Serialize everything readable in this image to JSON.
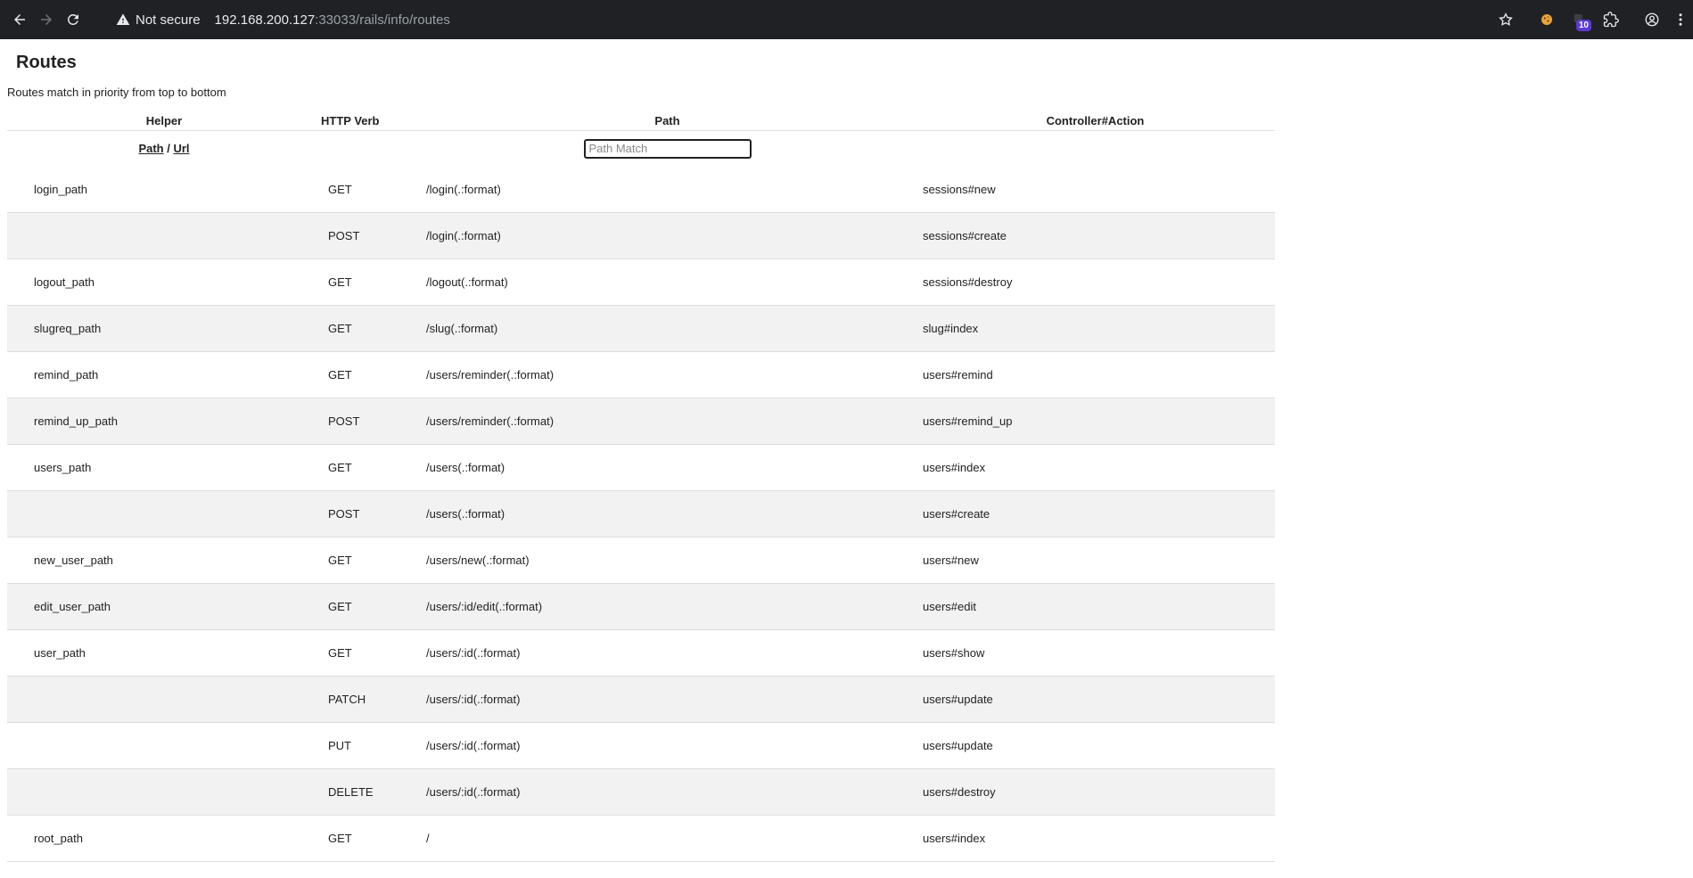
{
  "browser": {
    "security_label": "Not secure",
    "url_host": "192.168.200.127",
    "url_rest": ":33033/rails/info/routes",
    "extension_badge": "10",
    "icons": [
      "back-icon",
      "forward-icon",
      "reload-icon",
      "warning-icon",
      "star-icon",
      "extension-cookie-icon",
      "extension-badge-icon",
      "puzzle-icon",
      "profile-icon",
      "menu-icon"
    ]
  },
  "page": {
    "title": "Routes",
    "subtitle": "Routes match in priority from top to bottom"
  },
  "table": {
    "headers": {
      "helper": "Helper",
      "verb": "HTTP Verb",
      "path": "Path",
      "action": "Controller#Action"
    },
    "filter": {
      "path_link": "Path",
      "separator": " / ",
      "url_link": "Url",
      "search_placeholder": "Path Match"
    },
    "rows": [
      {
        "helper": "login_path",
        "verb": "GET",
        "path": "/login(.:format)",
        "action": "sessions#new"
      },
      {
        "helper": "",
        "verb": "POST",
        "path": "/login(.:format)",
        "action": "sessions#create"
      },
      {
        "helper": "logout_path",
        "verb": "GET",
        "path": "/logout(.:format)",
        "action": "sessions#destroy"
      },
      {
        "helper": "slugreq_path",
        "verb": "GET",
        "path": "/slug(.:format)",
        "action": "slug#index"
      },
      {
        "helper": "remind_path",
        "verb": "GET",
        "path": "/users/reminder(.:format)",
        "action": "users#remind"
      },
      {
        "helper": "remind_up_path",
        "verb": "POST",
        "path": "/users/reminder(.:format)",
        "action": "users#remind_up"
      },
      {
        "helper": "users_path",
        "verb": "GET",
        "path": "/users(.:format)",
        "action": "users#index"
      },
      {
        "helper": "",
        "verb": "POST",
        "path": "/users(.:format)",
        "action": "users#create"
      },
      {
        "helper": "new_user_path",
        "verb": "GET",
        "path": "/users/new(.:format)",
        "action": "users#new"
      },
      {
        "helper": "edit_user_path",
        "verb": "GET",
        "path": "/users/:id/edit(.:format)",
        "action": "users#edit"
      },
      {
        "helper": "user_path",
        "verb": "GET",
        "path": "/users/:id(.:format)",
        "action": "users#show"
      },
      {
        "helper": "",
        "verb": "PATCH",
        "path": "/users/:id(.:format)",
        "action": "users#update"
      },
      {
        "helper": "",
        "verb": "PUT",
        "path": "/users/:id(.:format)",
        "action": "users#update"
      },
      {
        "helper": "",
        "verb": "DELETE",
        "path": "/users/:id(.:format)",
        "action": "users#destroy"
      },
      {
        "helper": "root_path",
        "verb": "GET",
        "path": "/",
        "action": "users#index"
      }
    ]
  }
}
